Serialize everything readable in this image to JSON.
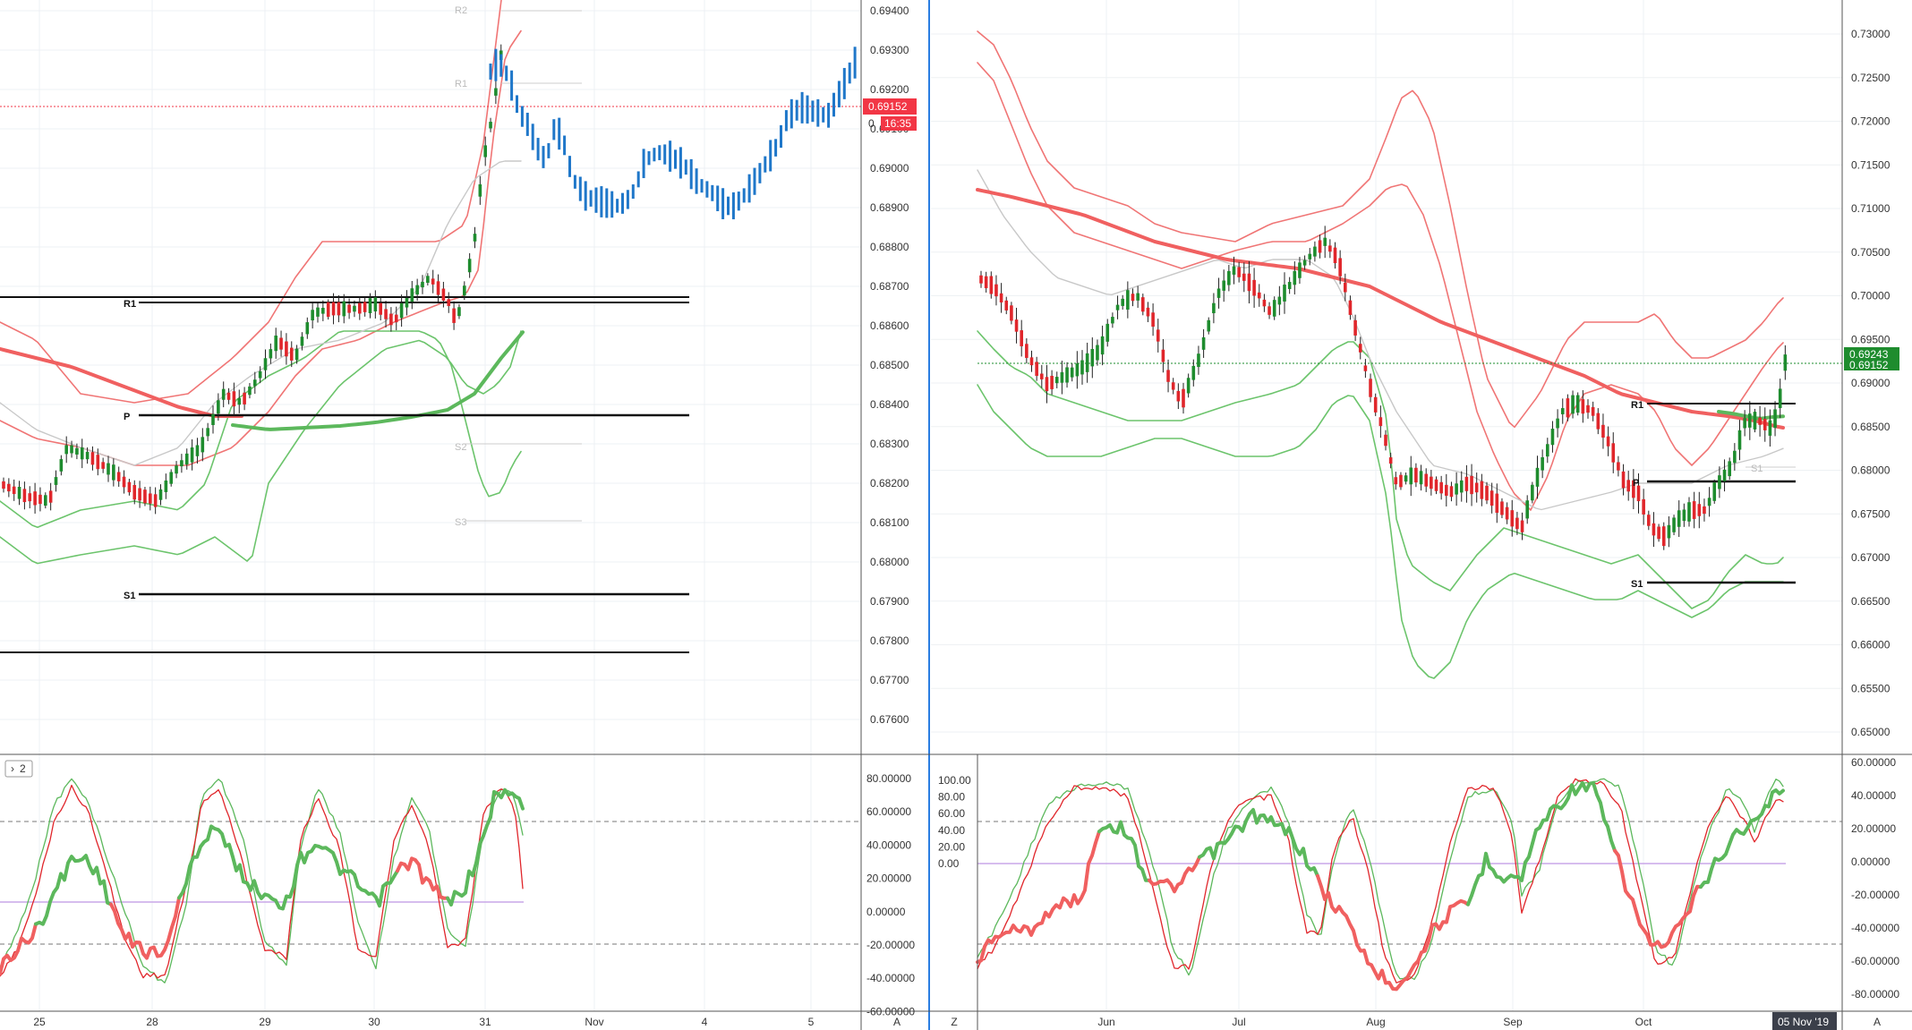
{
  "colors": {
    "bull": "#1e8c2e",
    "bear": "#e0262b",
    "blue": "#1f77c9",
    "red_band": "#f07575",
    "green_band": "#6cc46c",
    "ma_red": "#f06060",
    "ma_green": "#5cb85c",
    "grey": "#c8c8c8",
    "purple": "#c9a7e8",
    "badge_red": "#f23645",
    "badge_green": "#1e8c2e",
    "pane_blue": "#2a7de1"
  },
  "left": {
    "x_ticks": [
      "25",
      "28",
      "29",
      "30",
      "31",
      "Nov",
      "4",
      "5"
    ],
    "price_ticks": [
      "0.69400",
      "0.69300",
      "0.69200",
      "0.69100",
      "0.69000",
      "0.68900",
      "0.68800",
      "0.68700",
      "0.68600",
      "0.68500",
      "0.68400",
      "0.68300",
      "0.68200",
      "0.68100",
      "0.68000",
      "0.67900",
      "0.67800",
      "0.67700",
      "0.67600"
    ],
    "osc_ticks": [
      "80.00000",
      "60.00000",
      "40.00000",
      "20.00000",
      "0.00000",
      "-20.00000",
      "-40.00000",
      "-60.00000"
    ],
    "price_badge": "0.69152",
    "time_badge": "16:35",
    "time_badge_prefix": "0",
    "pivots": {
      "R2": "R2",
      "R1f": "R1",
      "R1": "R1",
      "P": "P",
      "S2": "S2",
      "S3": "S3",
      "S1": "S1"
    },
    "pane_label": "2",
    "scale_mode": "A",
    "chart_data": {
      "type": "candlestick",
      "pivots": {
        "R1": 0.6866,
        "P": 0.6837,
        "S1": 0.6792
      },
      "last_price": 0.69152
    }
  },
  "right": {
    "x_ticks": [
      "Jun",
      "Jul",
      "Aug",
      "Sep",
      "Oct"
    ],
    "price_ticks": [
      "0.73000",
      "0.72500",
      "0.72000",
      "0.71500",
      "0.71000",
      "0.70500",
      "0.70000",
      "0.69500",
      "0.69000",
      "0.68500",
      "0.68000",
      "0.67500",
      "0.67000",
      "0.66500",
      "0.66000",
      "0.65500",
      "0.65000"
    ],
    "osc_ticks": [
      "100.00",
      "80.00",
      "60.00",
      "40.00",
      "20.00",
      "0.00"
    ],
    "osc_ticks_right": [
      "60.00000",
      "40.00000",
      "20.00000",
      "0.00000",
      "-20.00000",
      "-40.00000",
      "-60.00000",
      "-80.00000"
    ],
    "price_badge": "0.69243",
    "price_badge_sub": "0.69152",
    "date_badge": "05 Nov '19",
    "pivots": {
      "R1": "R1",
      "P": "P",
      "S1f": "S1",
      "S1": "S1"
    },
    "scale_mode_left": "Z",
    "scale_mode_right": "A",
    "chart_data": {
      "type": "candlestick",
      "pivots": {
        "R1": 0.6867,
        "P": 0.6778,
        "S1": 0.6661
      },
      "last_price": 0.69243
    }
  }
}
